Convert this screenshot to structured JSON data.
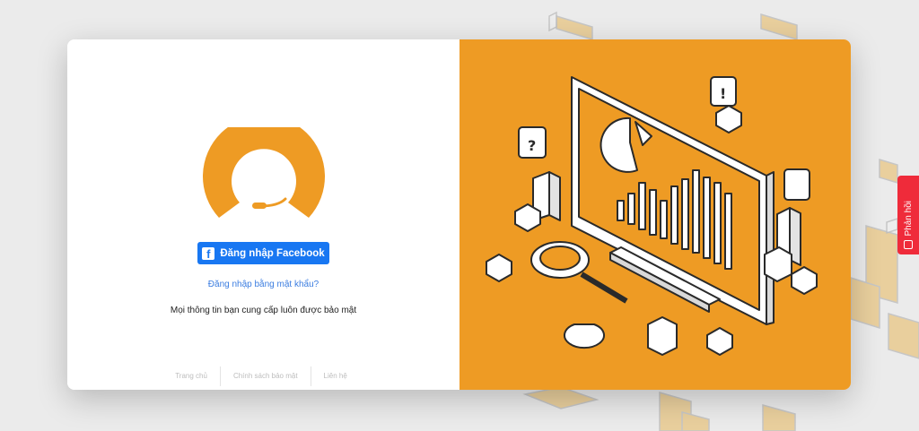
{
  "login": {
    "facebook_button": "Đăng nhập Facebook",
    "facebook_icon": "facebook-f-icon",
    "password_link": "Đăng nhập bằng mật khẩu?",
    "security_note": "Mọi thông tin bạn cung cấp luôn được bảo mật"
  },
  "footer": {
    "links": [
      "Trang chủ",
      "Chính sách bảo mật",
      "Liên hệ"
    ]
  },
  "feedback": {
    "label": "Phản hồi",
    "icon": "feedback-icon"
  },
  "colors": {
    "brand_orange": "#ee9b24",
    "facebook_blue": "#1877f2",
    "link_blue": "#3b7de0",
    "feedback_red": "#ef2b3a",
    "page_background": "#ebebeb"
  }
}
